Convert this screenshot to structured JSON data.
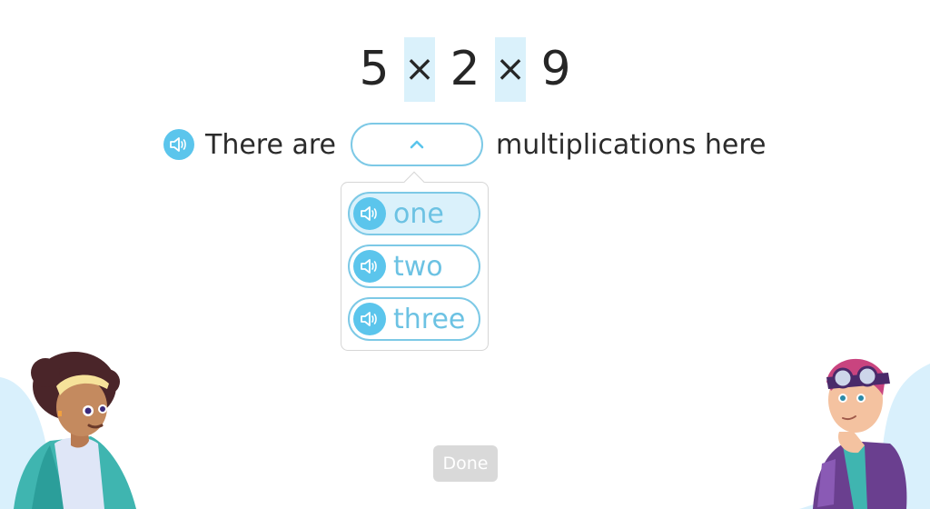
{
  "expression": {
    "tokens": [
      {
        "type": "number",
        "value": "5"
      },
      {
        "type": "operator",
        "value": "×",
        "highlighted": true
      },
      {
        "type": "number",
        "value": "2"
      },
      {
        "type": "operator",
        "value": "×",
        "highlighted": true
      },
      {
        "type": "number",
        "value": "9"
      }
    ]
  },
  "sentence": {
    "speaker_icon": "speaker-icon",
    "before": "There are",
    "after": "multiplications here",
    "dropdown": {
      "value": "",
      "icon": "chevron-up-icon",
      "expanded": true
    }
  },
  "menu": {
    "options": [
      {
        "label": "one",
        "icon": "speaker-icon",
        "highlighted": true
      },
      {
        "label": "two",
        "icon": "speaker-icon",
        "highlighted": false
      },
      {
        "label": "three",
        "icon": "speaker-icon",
        "highlighted": false
      }
    ]
  },
  "done_button": {
    "label": "Done",
    "enabled": false
  },
  "colors": {
    "accent": "#5bc5ec",
    "border": "#7dc9e6",
    "highlight": "#daf1fb",
    "option_text": "#6cc2e3",
    "done_disabled": "#d9d9d9"
  }
}
